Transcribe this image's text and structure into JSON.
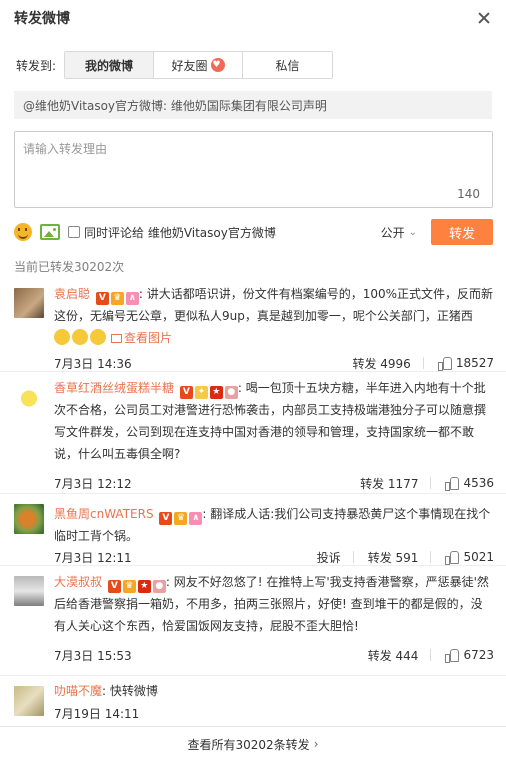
{
  "dialog": {
    "title": "转发微博"
  },
  "target": {
    "label": "转发到:",
    "options": [
      {
        "label": "我的微博",
        "active": true
      },
      {
        "label": "好友圈",
        "active": false
      },
      {
        "label": "私信",
        "active": false
      }
    ]
  },
  "quote": {
    "text": "@维他奶Vitasoy官方微博: 维他奶国际集团有限公司声明"
  },
  "composer": {
    "placeholder": "请输入转发理由",
    "counter": "140"
  },
  "toolbar": {
    "also_comment_label": "同时评论给 维他奶Vitasoy官方微博",
    "visibility": "公开",
    "send_label": "转发"
  },
  "repost_count_text": "当前已转发30202次",
  "reposts": [
    {
      "username": "袁启聪",
      "text": ": 讲大话都唔识讲，份文件有档案编号的，100%正式文件，反而新这份，无编号无公章，更似私人9up，真是越到加零一，呢个公关部门，正猪西",
      "pic_link": "查看图片",
      "time": "7月3日 14:36",
      "repost_label": "转发 4996",
      "likes": "18527"
    },
    {
      "username": "香草红酒丝绒蛋糕半糖",
      "text": ": 喝一包顶十五块方糖，半年进入内地有十个批次不合格，公司员工对港警进行恐怖袭击，内部员工支持极端港独分子可以随意撰写文件群发，公司到现在连支持中国对香港的领导和管理，支持国家统一都不敢说，什么叫五毒俱全啊?",
      "time": "7月3日 12:12",
      "repost_label": "转发 1177",
      "likes": "4536"
    },
    {
      "username": "黑鱼周cnWATERS",
      "text": ": 翻译成人话:我们公司支持暴恐黄尸这个事情现在找个临时工背个锅。",
      "time": "7月3日 12:11",
      "report_label": "投诉",
      "repost_label": "转发 591",
      "likes": "5021"
    },
    {
      "username": "大漠叔叔",
      "text": ": 网友不好忽悠了! 在推特上写'我支持香港警察，严惩暴徒'然后给香港警察捐一箱奶，不用多，拍两三张照片，好使! 查到堆干的都是假的，没有人关心这个东西，恰爱国饭网友支持，屁股不歪大胆恰!",
      "time": "7月3日 15:53",
      "repost_label": "转发 444",
      "likes": "6723"
    },
    {
      "username": "叻喵不魔",
      "text": ": 快转微博",
      "time": "7月19日 14:11"
    }
  ],
  "footer": {
    "view_all": "查看所有30202条转发",
    "arrow": "›"
  },
  "colors": {
    "accent": "#ff8140",
    "username": "#eb7350"
  }
}
